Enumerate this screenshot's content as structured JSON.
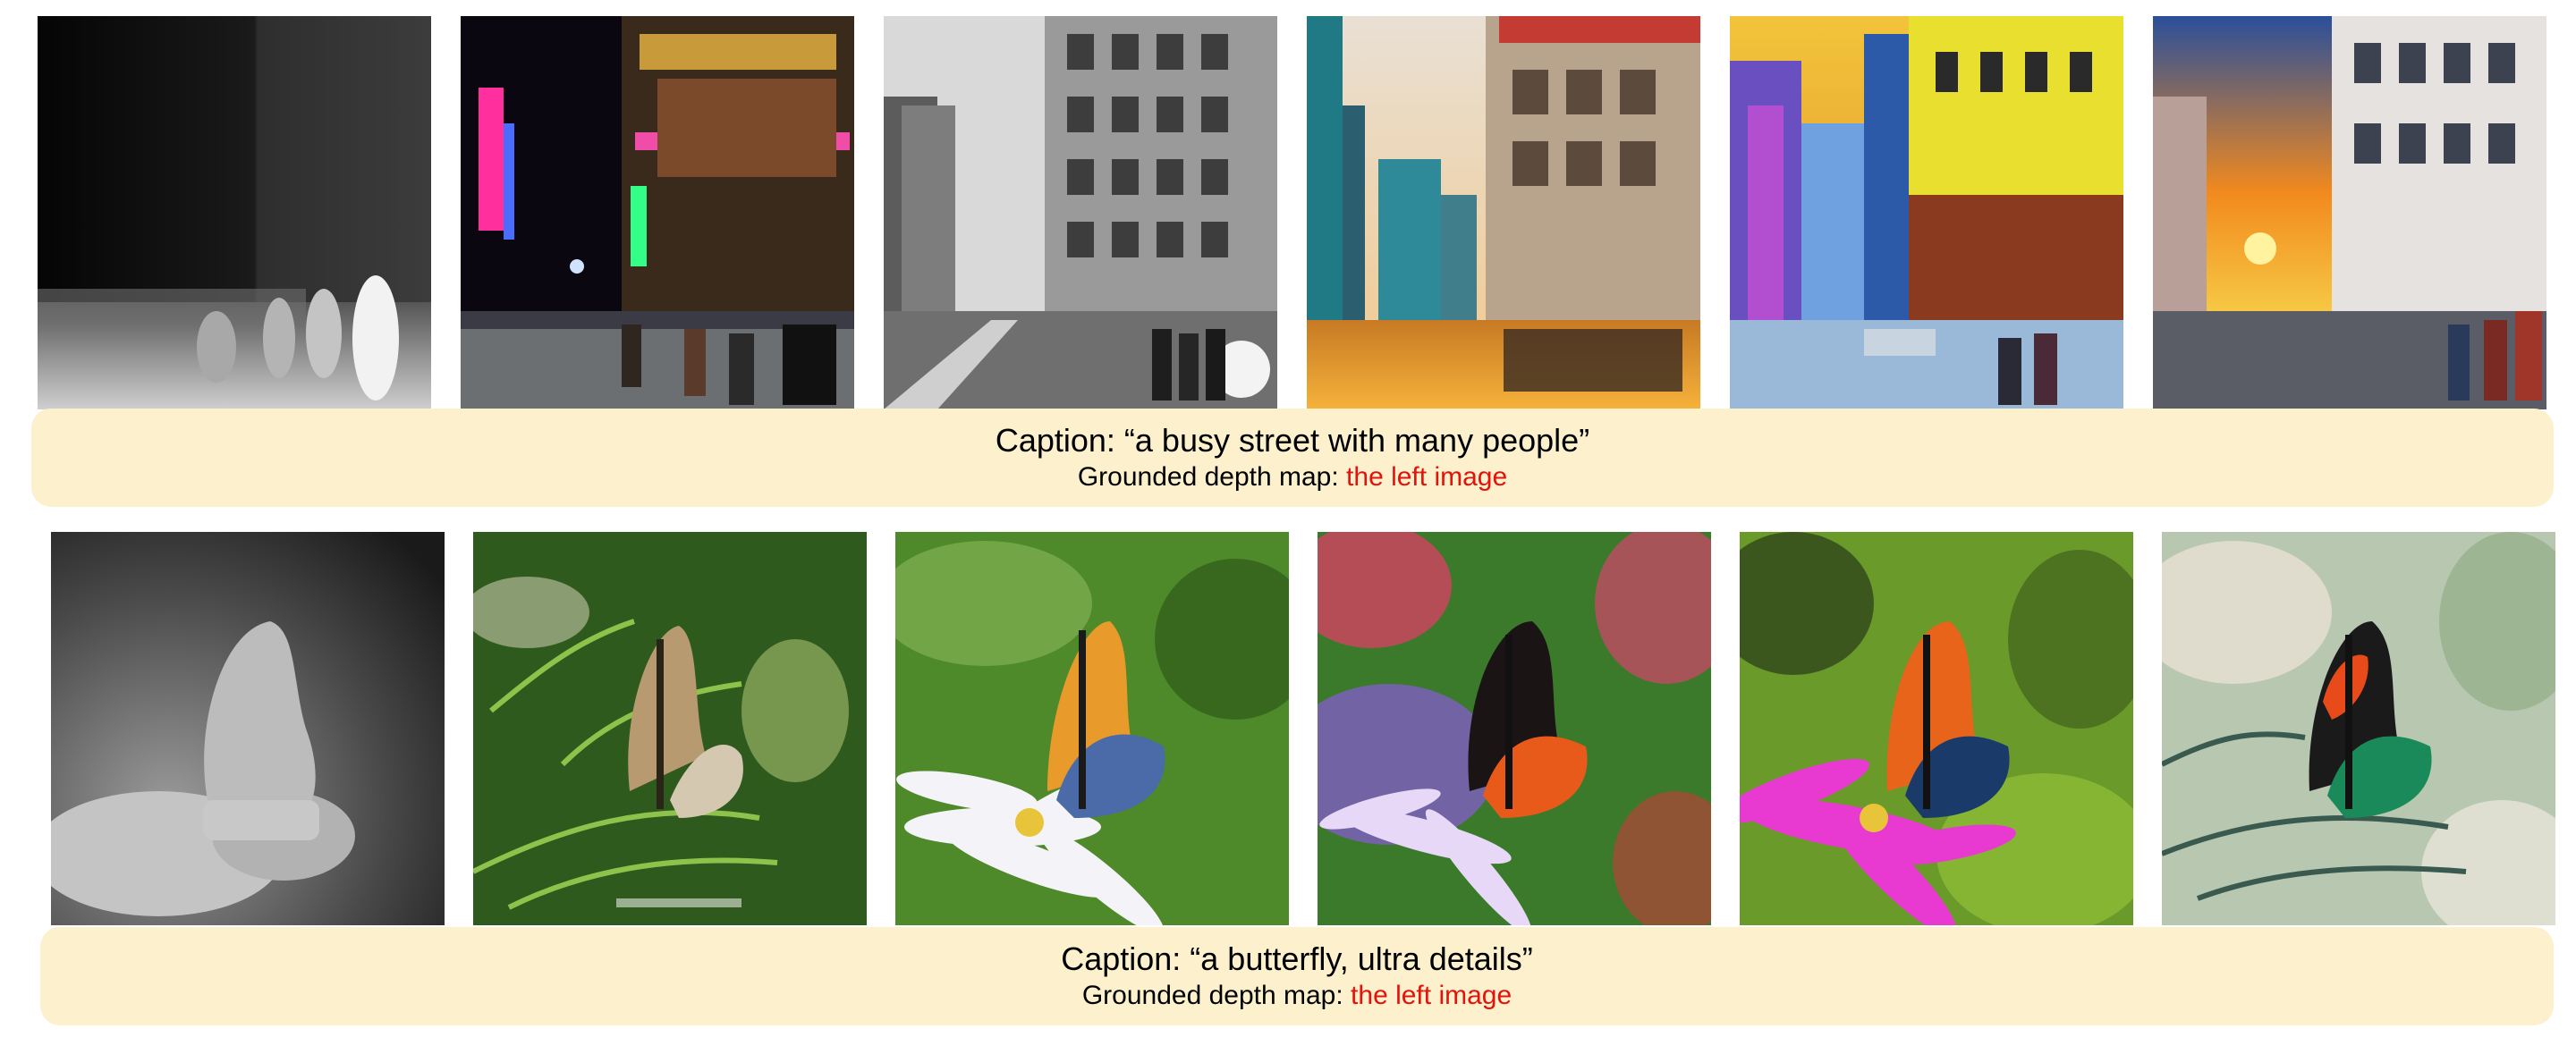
{
  "rows": [
    {
      "caption_prefix": "Caption: ",
      "caption_text": "“a busy street with many people”",
      "grounded_label": "Grounded depth map: ",
      "grounded_value": "the left image",
      "tiles": [
        "depth-map",
        "neon-night-street",
        "black-white-street",
        "golden-hour-street",
        "hdr-colorful-street",
        "sunset-street"
      ]
    },
    {
      "caption_prefix": "Caption: ",
      "caption_text": "“a butterfly, ultra details”",
      "grounded_label": "Grounded depth map: ",
      "grounded_value": "the left image",
      "tiles": [
        "depth-map",
        "butterfly-on-fern",
        "butterfly-on-white-daisy",
        "butterfly-on-purple-aster",
        "butterfly-on-magenta-flower",
        "butterfly-teal-painterly"
      ]
    }
  ],
  "colors": {
    "caption_bg": "#fdf0cd",
    "highlight": "#e3120b"
  }
}
